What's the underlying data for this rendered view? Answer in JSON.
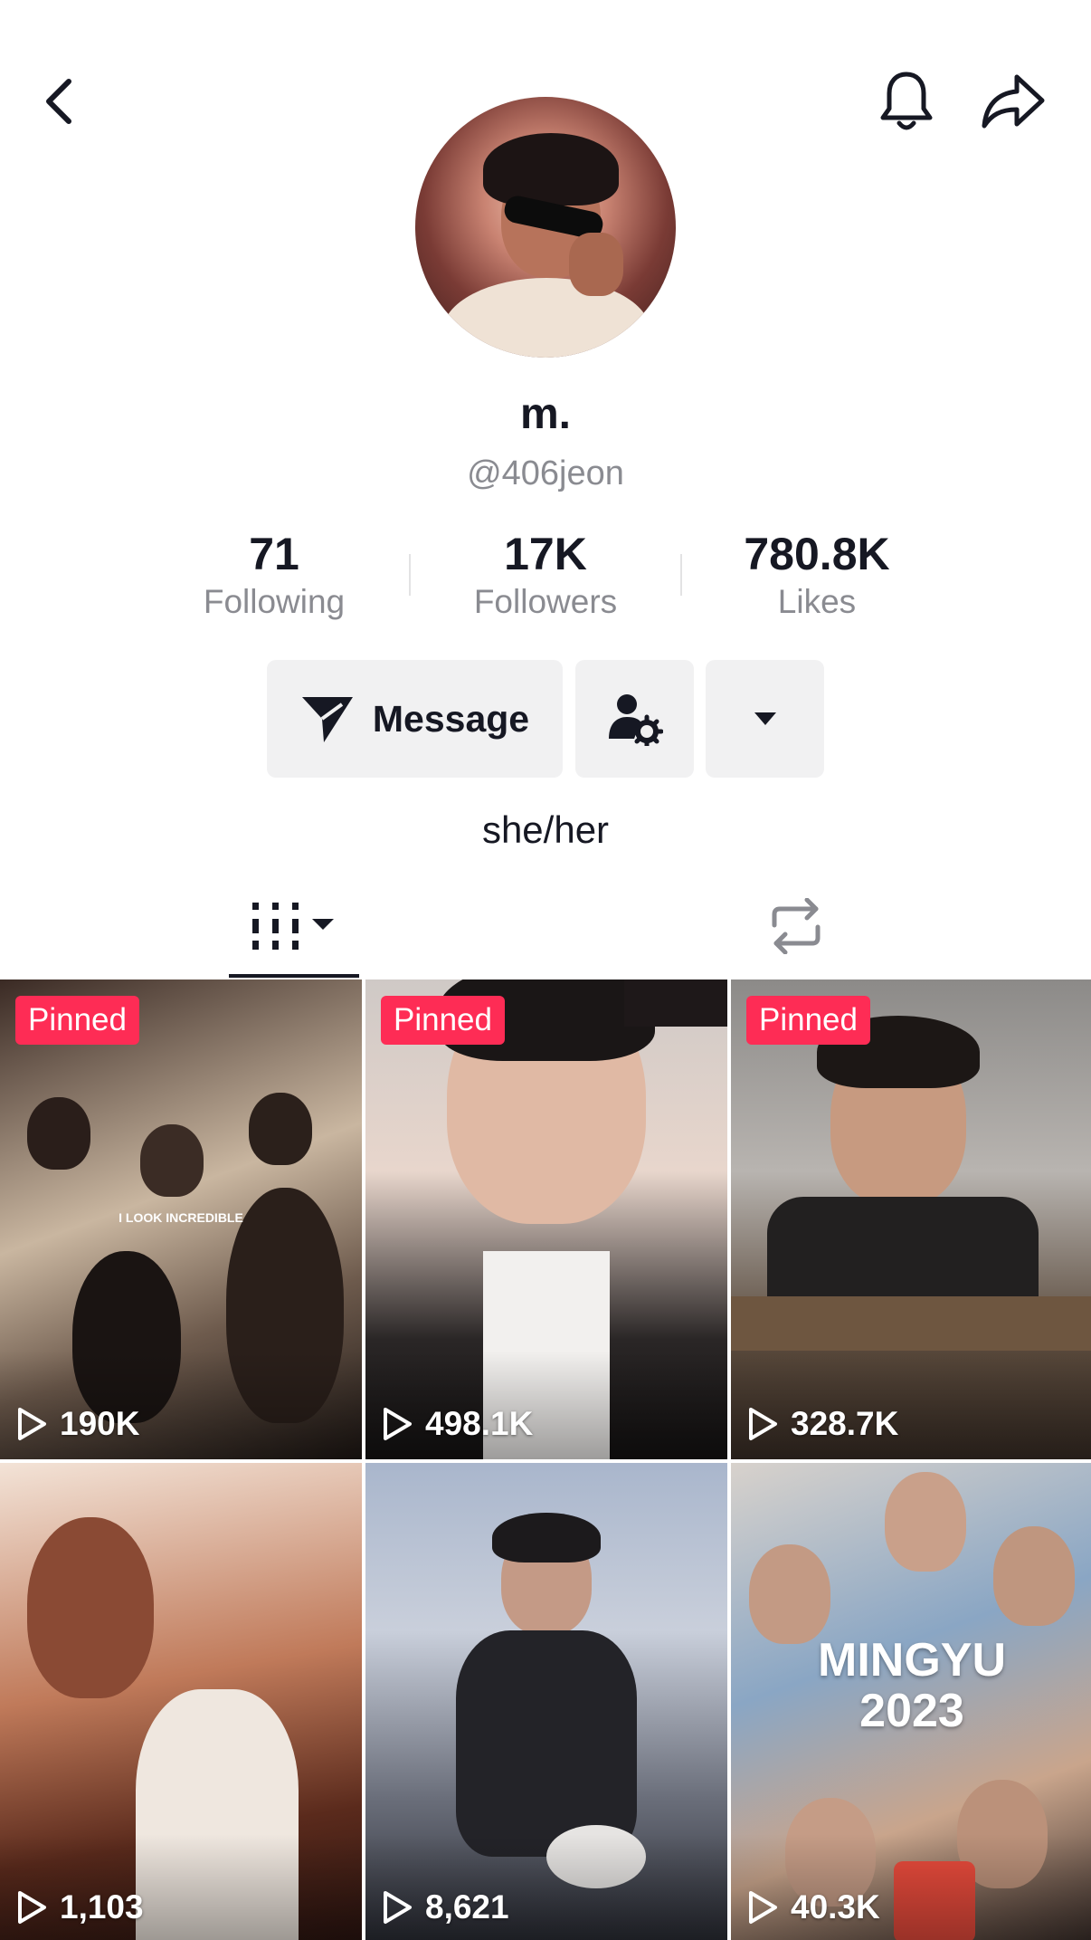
{
  "header": {
    "back_icon": "chevron-left-icon",
    "bell_icon": "bell-icon",
    "share_icon": "share-arrow-icon"
  },
  "profile": {
    "display_name": "m.",
    "handle": "@406jeon",
    "bio": "she/her"
  },
  "stats": [
    {
      "value": "71",
      "label": "Following"
    },
    {
      "value": "17K",
      "label": "Followers"
    },
    {
      "value": "780.8K",
      "label": "Likes"
    }
  ],
  "actions": {
    "message_label": "Message",
    "message_icon": "paper-plane-icon",
    "profile_settings_icon": "person-gear-icon",
    "more_icon": "caret-down-icon"
  },
  "tabs": {
    "videos_icon": "grid-columns-icon",
    "reposts_icon": "repost-icon"
  },
  "videos": [
    {
      "pinned": "Pinned",
      "views": "190K",
      "overlay": "I LOOK INCREDIBLE"
    },
    {
      "pinned": "Pinned",
      "views": "498.1K"
    },
    {
      "pinned": "Pinned",
      "views": "328.7K"
    },
    {
      "views": "1,103"
    },
    {
      "views": "8,621"
    },
    {
      "views": "40.3K",
      "overlay_line1": "MINGYU",
      "overlay_line2": "2023"
    }
  ],
  "colors": {
    "accent": "#fe2c55",
    "text_primary": "#161823",
    "text_secondary": "#8a8b91",
    "button_bg": "#f1f1f2"
  }
}
